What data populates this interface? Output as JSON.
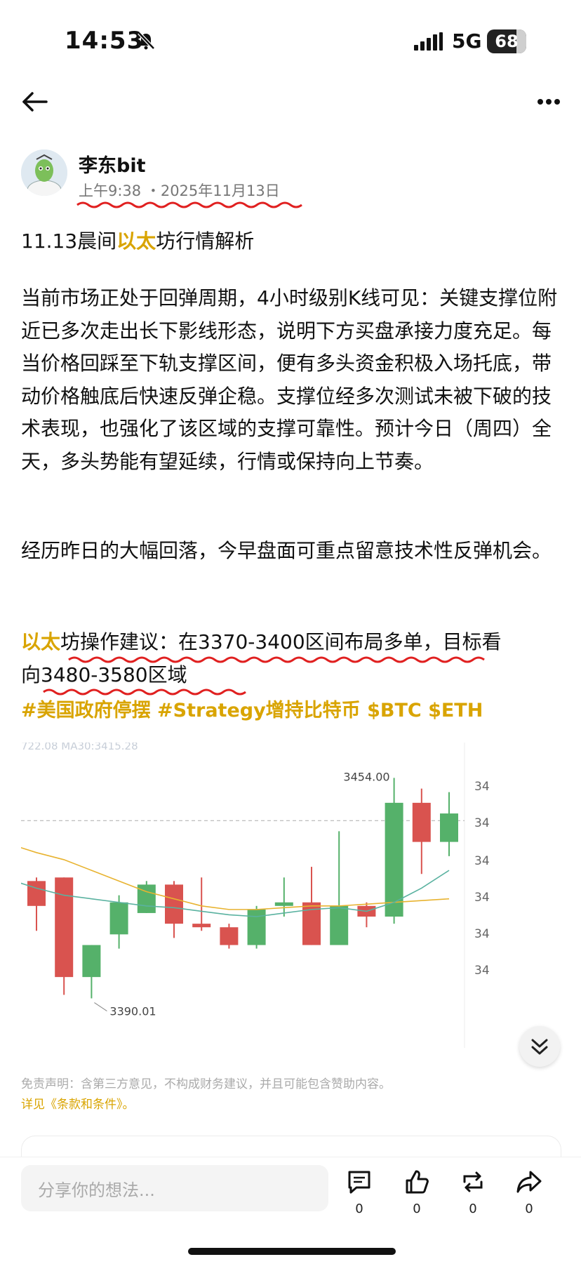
{
  "status_bar": {
    "time": "14:53",
    "network": "5G",
    "battery": "68"
  },
  "post": {
    "author": "李东bit",
    "date": "上午9:38 ・2025年11月13日",
    "title_pre": "11.13晨间",
    "title_hl": "以太",
    "title_post": "坊行情解析",
    "para1": "当前市场正处于回弹周期，4小时级别K线可见：关键支撑位附近已多次走出长下影线形态，说明下方买盘承接力度充足。每当价格回踩至下轨支撑区间，便有多头资金积极入场托底，带动价格触底后快速反弹企稳。支撑位经多次测试未被下破的技术表现，也强化了该区域的支撑可靠性。预计今日（周四）全天，多头势能有望延续，行情或保持向上节奏。",
    "para2": "经历昨日的大幅回落，今早盘面可重点留意技术性反弹机会。",
    "para3_hl": "以太",
    "para3_line1": "坊操作建议：在3370-3400区间布局多单，目标看",
    "para3_line2": "向3480-3580区域",
    "tags": "#美国政府停摆 #Strategy增持比特币 $BTC $ETH"
  },
  "chart_header": "722.08  MA30:3415.28",
  "chart_data": {
    "type": "candlestick",
    "annotations": {
      "high_label": "3454.00",
      "low_label": "3390.01"
    },
    "y_tick_labels": [
      "34",
      "34",
      "34",
      "34",
      "34",
      "34"
    ],
    "candles": [
      {
        "open": 3425.0,
        "close": 3418.0,
        "high": 3426.0,
        "low": 3411.0
      },
      {
        "open": 3426.0,
        "close": 3398.0,
        "high": 3426.0,
        "low": 3393.0
      },
      {
        "open": 3398.0,
        "close": 3407.0,
        "high": 3407.0,
        "low": 3392.0
      },
      {
        "open": 3410.0,
        "close": 3419.0,
        "high": 3421.0,
        "low": 3406.0
      },
      {
        "open": 3416.0,
        "close": 3424.0,
        "high": 3425.0,
        "low": 3416.0
      },
      {
        "open": 3424.0,
        "close": 3413.0,
        "high": 3425.0,
        "low": 3409.0
      },
      {
        "open": 3413.0,
        "close": 3412.0,
        "high": 3426.0,
        "low": 3411.0
      },
      {
        "open": 3412.0,
        "close": 3407.0,
        "high": 3413.0,
        "low": 3406.0
      },
      {
        "open": 3407.0,
        "close": 3417.0,
        "high": 3418.0,
        "low": 3406.0
      },
      {
        "open": 3418.0,
        "close": 3419.0,
        "high": 3426.0,
        "low": 3415.0
      },
      {
        "open": 3419.0,
        "close": 3407.0,
        "high": 3429.0,
        "low": 3407.0
      },
      {
        "open": 3407.0,
        "close": 3418.0,
        "high": 3439.0,
        "low": 3407.0
      },
      {
        "open": 3418.0,
        "close": 3415.0,
        "high": 3419.0,
        "low": 3412.0
      },
      {
        "open": 3415.0,
        "close": 3447.0,
        "high": 3454.0,
        "low": 3413.0
      },
      {
        "open": 3447.0,
        "close": 3436.0,
        "high": 3451.0,
        "low": 3427.0
      },
      {
        "open": 3436.0,
        "close": 3444.0,
        "high": 3450.0,
        "low": 3432.0
      }
    ],
    "ma_series": [
      {
        "name": "MA30",
        "color": "#e8b330",
        "values": [
          3433.0,
          3431.0,
          3428.0,
          3425.0,
          3422.0,
          3420.0,
          3418.0,
          3417.0,
          3417.0,
          3417.5,
          3418.0,
          3418.0,
          3418.5,
          3419.0,
          3419.5,
          3420.0
        ]
      },
      {
        "name": "MA",
        "color": "#5ab2a0",
        "values": [
          3423.0,
          3421.0,
          3420.0,
          3419.0,
          3418.0,
          3417.5,
          3416.5,
          3415.5,
          3415.0,
          3416.0,
          3417.0,
          3417.5,
          3416.5,
          3419.0,
          3423.0,
          3428.0
        ]
      }
    ],
    "current_price_line": 3442.0,
    "colors": {
      "up": "#55b16a",
      "down": "#d9534f"
    }
  },
  "disclaimer": "免责声明：含第三方意见，不构成财务建议，并且可能包含赞助内容。",
  "terms": "详见《条款和条件》。",
  "bottom": {
    "placeholder": "分享你的想法...",
    "comment_count": "0",
    "like_count": "0",
    "repost_count": "0",
    "share_count": "0"
  },
  "colors": {
    "accent": "#d9a400",
    "underline": "#e02020"
  },
  "icons": [
    "back-arrow-icon",
    "more-icon",
    "bell-mute-icon",
    "signal-icon",
    "comment-icon",
    "like-icon",
    "repost-icon",
    "share-icon",
    "double-chevron-down-icon"
  ]
}
